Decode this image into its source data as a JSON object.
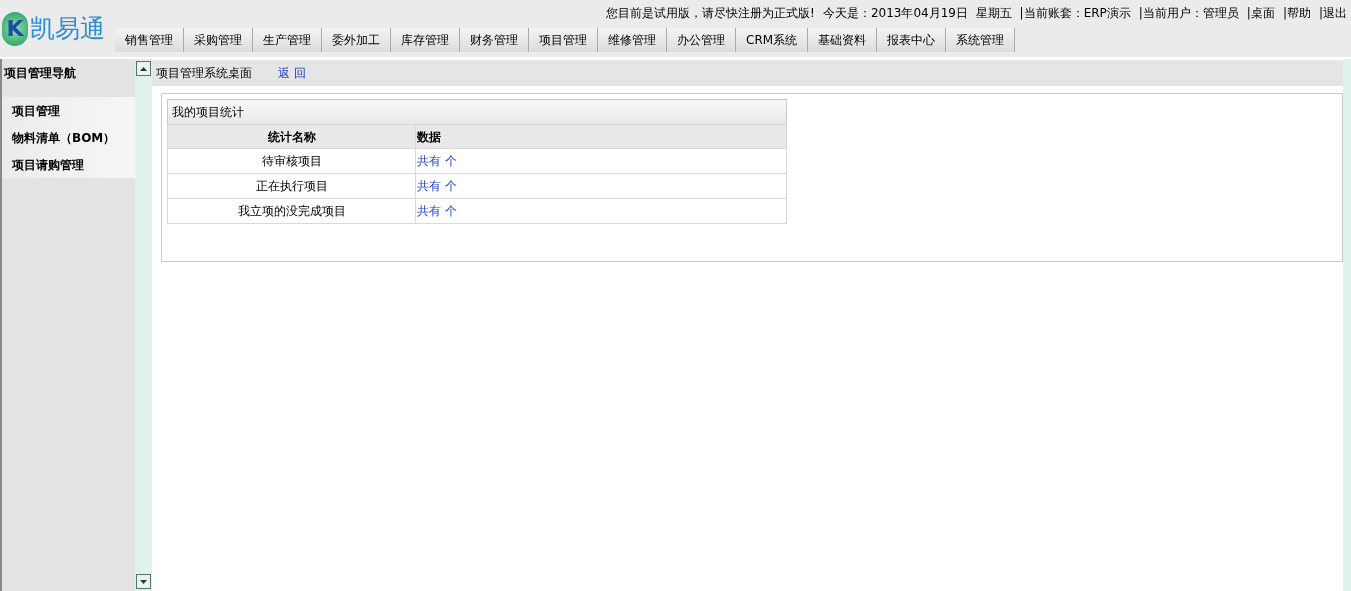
{
  "logo": {
    "letter": "K",
    "name": "凯易通"
  },
  "top_bar": {
    "notice": "您目前是试用版，请尽快注册为正式版!",
    "date": "今天是：2013年04月19日  星期五",
    "account": "|当前账套：ERP演示",
    "user": "|当前用户：管理员",
    "links": [
      "|桌面",
      "|帮助",
      "|退出"
    ]
  },
  "nav_tabs": [
    "销售管理",
    "采购管理",
    "生产管理",
    "委外加工",
    "库存管理",
    "财务管理",
    "项目管理",
    "维修管理",
    "办公管理",
    "CRM系统",
    "基础资料",
    "报表中心",
    "系统管理"
  ],
  "sidebar": {
    "title": "项目管理导航",
    "items": [
      "项目管理",
      "物料清单（BOM）",
      "项目请购管理"
    ]
  },
  "breadcrumb": {
    "title": "项目管理系统桌面",
    "back": "返 回"
  },
  "stats_table": {
    "title": "我的项目统计",
    "columns": [
      "统计名称",
      "数据"
    ],
    "rows": [
      {
        "name": "待审核项目",
        "data": "共有 个"
      },
      {
        "name": "正在执行项目",
        "data": "共有 个"
      },
      {
        "name": "我立项的没完成项目",
        "data": "共有 个"
      }
    ]
  }
}
